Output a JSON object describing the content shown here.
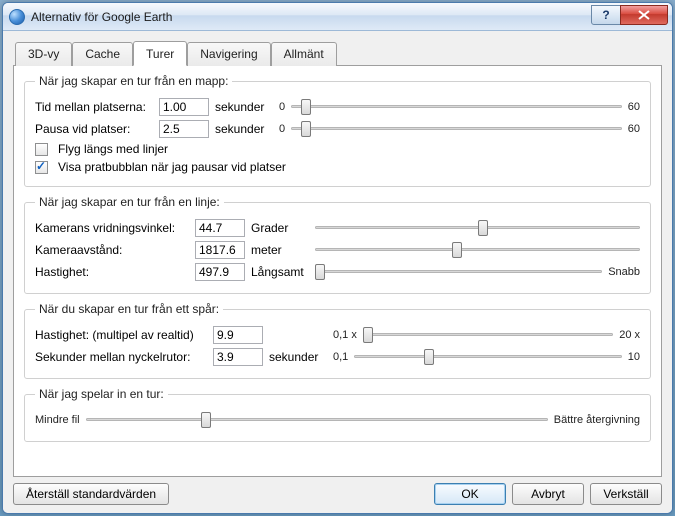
{
  "window": {
    "title": "Alternativ för Google Earth"
  },
  "tabs": [
    "3D-vy",
    "Cache",
    "Turer",
    "Navigering",
    "Allmänt"
  ],
  "activeTab": "Turer",
  "folder": {
    "legend": "När jag skapar en tur från en mapp:",
    "timeBetween": {
      "label": "Tid mellan platserna:",
      "value": "1.00",
      "unit": "sekunder",
      "min": "0",
      "max": "60",
      "pos": 3
    },
    "pauseAt": {
      "label": "Pausa vid platser:",
      "value": "2.5",
      "unit": "sekunder",
      "min": "0",
      "max": "60",
      "pos": 3
    },
    "flyAlong": {
      "label": "Flyg längs med linjer",
      "checked": false
    },
    "showBalloon": {
      "label": "Visa pratbubblan när jag pausar vid platser",
      "checked": true
    }
  },
  "line": {
    "legend": "När jag skapar en tur från en linje:",
    "angle": {
      "label": "Kamerans vridningsvinkel:",
      "value": "44.7",
      "unit": "Grader",
      "pos": 50
    },
    "distance": {
      "label": "Kameraavstånd:",
      "value": "1817.6",
      "unit": "meter",
      "pos": 42
    },
    "speed": {
      "label": "Hastighet:",
      "value": "497.9",
      "minLabel": "Långsamt",
      "maxLabel": "Snabb",
      "pos": 0
    }
  },
  "track": {
    "legend": "När du skapar en tur från ett spår:",
    "speed": {
      "label": "Hastighet: (multipel av realtid)",
      "value": "9.9",
      "min": "0,1 x",
      "max": "20 x",
      "pos": 0
    },
    "keyframes": {
      "label": "Sekunder mellan nyckelrutor:",
      "value": "3.9",
      "unit": "sekunder",
      "min": "0,1",
      "max": "10",
      "pos": 26
    }
  },
  "record": {
    "legend": "När jag spelar in en tur:",
    "quality": {
      "minLabel": "Mindre fil",
      "maxLabel": "Bättre återgivning",
      "pos": 25
    }
  },
  "footer": {
    "reset": "Återställ standardvärden",
    "ok": "OK",
    "cancel": "Avbryt",
    "apply": "Verkställ"
  }
}
